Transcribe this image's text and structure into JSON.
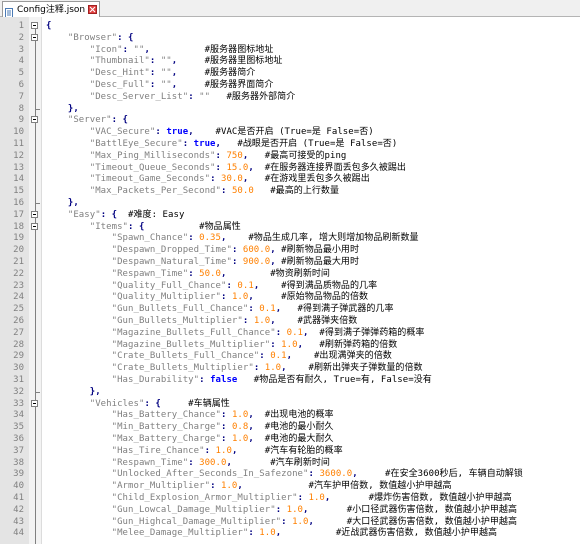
{
  "tab": {
    "label": "Config注释.json"
  },
  "lines": [
    {
      "n": "1",
      "fold": "open",
      "parts": [
        [
          "p",
          "{"
        ]
      ]
    },
    {
      "n": "2",
      "fold": "open",
      "parts": [
        [
          "k",
          "    \"Browser\""
        ],
        [
          "p",
          ": {"
        ]
      ]
    },
    {
      "n": "3",
      "parts": [
        [
          "k",
          "        \"Icon\""
        ],
        [
          "p",
          ": "
        ],
        [
          "s",
          "\"\""
        ],
        [
          "p",
          ","
        ],
        [
          "c",
          "          #服务器图标地址"
        ]
      ]
    },
    {
      "n": "4",
      "parts": [
        [
          "k",
          "        \"Thumbnail\""
        ],
        [
          "p",
          ": "
        ],
        [
          "s",
          "\"\""
        ],
        [
          "p",
          ","
        ],
        [
          "c",
          "     #服务器里图标地址"
        ]
      ]
    },
    {
      "n": "5",
      "parts": [
        [
          "k",
          "        \"Desc_Hint\""
        ],
        [
          "p",
          ": "
        ],
        [
          "s",
          "\"\""
        ],
        [
          "p",
          ","
        ],
        [
          "c",
          "     #服务器简介"
        ]
      ]
    },
    {
      "n": "6",
      "parts": [
        [
          "k",
          "        \"Desc_Full\""
        ],
        [
          "p",
          ": "
        ],
        [
          "s",
          "\"\""
        ],
        [
          "p",
          ","
        ],
        [
          "c",
          "     #服务器界面简介"
        ]
      ]
    },
    {
      "n": "7",
      "parts": [
        [
          "k",
          "        \"Desc_Server_List\""
        ],
        [
          "p",
          ": "
        ],
        [
          "s",
          "\"\""
        ],
        [
          "c",
          "   #服务器外部简介"
        ]
      ]
    },
    {
      "n": "8",
      "fold": "end",
      "parts": [
        [
          "p",
          "    },"
        ]
      ]
    },
    {
      "n": "9",
      "fold": "open",
      "parts": [
        [
          "k",
          "    \"Server\""
        ],
        [
          "p",
          ": {"
        ]
      ]
    },
    {
      "n": "10",
      "parts": [
        [
          "k",
          "        \"VAC_Secure\""
        ],
        [
          "p",
          ": "
        ],
        [
          "b",
          "true"
        ],
        [
          "p",
          ","
        ],
        [
          "c",
          "    #VAC是否开启 (True=是 False=否)"
        ]
      ]
    },
    {
      "n": "11",
      "parts": [
        [
          "k",
          "        \"BattlEye_Secure\""
        ],
        [
          "p",
          ": "
        ],
        [
          "b",
          "true"
        ],
        [
          "p",
          ","
        ],
        [
          "c",
          "   #战眼是否开启 (True=是 False=否)"
        ]
      ]
    },
    {
      "n": "12",
      "parts": [
        [
          "k",
          "        \"Max_Ping_Milliseconds\""
        ],
        [
          "p",
          ": "
        ],
        [
          "n",
          "750"
        ],
        [
          "p",
          ","
        ],
        [
          "c",
          "   #最高可接受的ping"
        ]
      ]
    },
    {
      "n": "13",
      "parts": [
        [
          "k",
          "        \"Timeout_Queue_Seconds\""
        ],
        [
          "p",
          ": "
        ],
        [
          "n",
          "15.0"
        ],
        [
          "p",
          ","
        ],
        [
          "c",
          "  #在服务器连接界面丢包多久被踢出"
        ]
      ]
    },
    {
      "n": "14",
      "parts": [
        [
          "k",
          "        \"Timeout_Game_Seconds\""
        ],
        [
          "p",
          ": "
        ],
        [
          "n",
          "30.0"
        ],
        [
          "p",
          ","
        ],
        [
          "c",
          "   #在游戏里丢包多久被踢出"
        ]
      ]
    },
    {
      "n": "15",
      "parts": [
        [
          "k",
          "        \"Max_Packets_Per_Second\""
        ],
        [
          "p",
          ": "
        ],
        [
          "n",
          "50.0"
        ],
        [
          "c",
          "   #最高的上行数量"
        ]
      ]
    },
    {
      "n": "16",
      "fold": "end",
      "parts": [
        [
          "p",
          "    },"
        ]
      ]
    },
    {
      "n": "17",
      "fold": "open",
      "parts": [
        [
          "k",
          "    \"Easy\""
        ],
        [
          "p",
          ": {"
        ],
        [
          "c",
          "  #难度: Easy"
        ]
      ]
    },
    {
      "n": "18",
      "fold": "open",
      "parts": [
        [
          "k",
          "        \"Items\""
        ],
        [
          "p",
          ": {"
        ],
        [
          "c",
          "          #物品属性"
        ]
      ]
    },
    {
      "n": "19",
      "parts": [
        [
          "k",
          "            \"Spawn_Chance\""
        ],
        [
          "p",
          ": "
        ],
        [
          "n",
          "0.35"
        ],
        [
          "p",
          ","
        ],
        [
          "c",
          "    #物品生成几率, 增大则增加物品刷新数量"
        ]
      ]
    },
    {
      "n": "20",
      "parts": [
        [
          "k",
          "            \"Despawn_Dropped_Time\""
        ],
        [
          "p",
          ": "
        ],
        [
          "n",
          "600.0"
        ],
        [
          "p",
          ","
        ],
        [
          "c",
          " #刷新物品最小用时"
        ]
      ]
    },
    {
      "n": "21",
      "parts": [
        [
          "k",
          "            \"Despawn_Natural_Time\""
        ],
        [
          "p",
          ": "
        ],
        [
          "n",
          "900.0"
        ],
        [
          "p",
          ","
        ],
        [
          "c",
          " #刷新物品最大用时"
        ]
      ]
    },
    {
      "n": "22",
      "parts": [
        [
          "k",
          "            \"Respawn_Time\""
        ],
        [
          "p",
          ": "
        ],
        [
          "n",
          "50.0"
        ],
        [
          "p",
          ","
        ],
        [
          "c",
          "        #物资刷新时间"
        ]
      ]
    },
    {
      "n": "23",
      "parts": [
        [
          "k",
          "            \"Quality_Full_Chance\""
        ],
        [
          "p",
          ": "
        ],
        [
          "n",
          "0.1"
        ],
        [
          "p",
          ","
        ],
        [
          "c",
          "    #得到满品质物品的几率"
        ]
      ]
    },
    {
      "n": "24",
      "parts": [
        [
          "k",
          "            \"Quality_Multiplier\""
        ],
        [
          "p",
          ": "
        ],
        [
          "n",
          "1.0"
        ],
        [
          "p",
          ","
        ],
        [
          "c",
          "     #原始物品物品的倍数"
        ]
      ]
    },
    {
      "n": "25",
      "parts": [
        [
          "k",
          "            \"Gun_Bullets_Full_Chance\""
        ],
        [
          "p",
          ": "
        ],
        [
          "n",
          "0.1"
        ],
        [
          "p",
          ","
        ],
        [
          "c",
          "   #得到满子弹武器的几率"
        ]
      ]
    },
    {
      "n": "26",
      "parts": [
        [
          "k",
          "            \"Gun_Bullets_Multiplier\""
        ],
        [
          "p",
          ": "
        ],
        [
          "n",
          "1.0"
        ],
        [
          "p",
          ","
        ],
        [
          "c",
          "    #武器弹夹倍数"
        ]
      ]
    },
    {
      "n": "27",
      "parts": [
        [
          "k",
          "            \"Magazine_Bullets_Full_Chance\""
        ],
        [
          "p",
          ": "
        ],
        [
          "n",
          "0.1"
        ],
        [
          "p",
          ","
        ],
        [
          "c",
          "  #得到满子弹弹药箱的概率"
        ]
      ]
    },
    {
      "n": "28",
      "parts": [
        [
          "k",
          "            \"Magazine_Bullets_Multiplier\""
        ],
        [
          "p",
          ": "
        ],
        [
          "n",
          "1.0"
        ],
        [
          "p",
          ","
        ],
        [
          "c",
          "   #刷新弹药箱的倍数"
        ]
      ]
    },
    {
      "n": "29",
      "parts": [
        [
          "k",
          "            \"Crate_Bullets_Full_Chance\""
        ],
        [
          "p",
          ": "
        ],
        [
          "n",
          "0.1"
        ],
        [
          "p",
          ","
        ],
        [
          "c",
          "    #出现满弹夹的倍数"
        ]
      ]
    },
    {
      "n": "30",
      "parts": [
        [
          "k",
          "            \"Crate_Bullets_Multiplier\""
        ],
        [
          "p",
          ": "
        ],
        [
          "n",
          "1.0"
        ],
        [
          "p",
          ","
        ],
        [
          "c",
          "    #刷新出弹夹子弹数量的倍数"
        ]
      ]
    },
    {
      "n": "31",
      "parts": [
        [
          "k",
          "            \"Has_Durability\""
        ],
        [
          "p",
          ": "
        ],
        [
          "b",
          "false"
        ],
        [
          "c",
          "   #物品是否有耐久, True=有, False=没有"
        ]
      ]
    },
    {
      "n": "32",
      "fold": "end",
      "parts": [
        [
          "p",
          "        },"
        ]
      ]
    },
    {
      "n": "33",
      "fold": "open",
      "parts": [
        [
          "k",
          "        \"Vehicles\""
        ],
        [
          "p",
          ": {"
        ],
        [
          "c",
          "     #车辆属性"
        ]
      ]
    },
    {
      "n": "34",
      "parts": [
        [
          "k",
          "            \"Has_Battery_Chance\""
        ],
        [
          "p",
          ": "
        ],
        [
          "n",
          "1.0"
        ],
        [
          "p",
          ","
        ],
        [
          "c",
          "  #出现电池的概率"
        ]
      ]
    },
    {
      "n": "35",
      "parts": [
        [
          "k",
          "            \"Min_Battery_Charge\""
        ],
        [
          "p",
          ": "
        ],
        [
          "n",
          "0.8"
        ],
        [
          "p",
          ","
        ],
        [
          "c",
          "  #电池的最小耐久"
        ]
      ]
    },
    {
      "n": "36",
      "parts": [
        [
          "k",
          "            \"Max_Battery_Charge\""
        ],
        [
          "p",
          ": "
        ],
        [
          "n",
          "1.0"
        ],
        [
          "p",
          ","
        ],
        [
          "c",
          "  #电池的最大耐久"
        ]
      ]
    },
    {
      "n": "37",
      "parts": [
        [
          "k",
          "            \"Has_Tire_Chance\""
        ],
        [
          "p",
          ": "
        ],
        [
          "n",
          "1.0"
        ],
        [
          "p",
          ","
        ],
        [
          "c",
          "     #汽车有轮胎的概率"
        ]
      ]
    },
    {
      "n": "38",
      "parts": [
        [
          "k",
          "            \"Respawn_Time\""
        ],
        [
          "p",
          ": "
        ],
        [
          "n",
          "300.0"
        ],
        [
          "p",
          ","
        ],
        [
          "c",
          "       #汽车刷新时间"
        ]
      ]
    },
    {
      "n": "39",
      "parts": [
        [
          "k",
          "            \"Unlocked_After_Seconds_In_Safezone\""
        ],
        [
          "p",
          ": "
        ],
        [
          "n",
          "3600.0"
        ],
        [
          "p",
          ","
        ],
        [
          "c",
          "     #在安全3600秒后, 车辆自动解锁"
        ]
      ]
    },
    {
      "n": "40",
      "parts": [
        [
          "k",
          "            \"Armor_Multiplier\""
        ],
        [
          "p",
          ": "
        ],
        [
          "n",
          "1.0"
        ],
        [
          "p",
          ","
        ],
        [
          "c",
          "            #汽车护甲倍数, 数值越小护甲越高"
        ]
      ]
    },
    {
      "n": "41",
      "parts": [
        [
          "k",
          "            \"Child_Explosion_Armor_Multiplier\""
        ],
        [
          "p",
          ": "
        ],
        [
          "n",
          "1.0"
        ],
        [
          "p",
          ","
        ],
        [
          "c",
          "       #爆炸伤害倍数, 数值越小护甲越高"
        ]
      ]
    },
    {
      "n": "42",
      "parts": [
        [
          "k",
          "            \"Gun_Lowcal_Damage_Multiplier\""
        ],
        [
          "p",
          ": "
        ],
        [
          "n",
          "1.0"
        ],
        [
          "p",
          ","
        ],
        [
          "c",
          "       #小口径武器伤害倍数, 数值越小护甲越高"
        ]
      ]
    },
    {
      "n": "43",
      "parts": [
        [
          "k",
          "            \"Gun_Highcal_Damage_Multiplier\""
        ],
        [
          "p",
          ": "
        ],
        [
          "n",
          "1.0"
        ],
        [
          "p",
          ","
        ],
        [
          "c",
          "      #大口径武器伤害倍数, 数值越小护甲越高"
        ]
      ]
    },
    {
      "n": "44",
      "parts": [
        [
          "k",
          "            \"Melee_Damage_Multiplier\""
        ],
        [
          "p",
          ": "
        ],
        [
          "n",
          "1.0"
        ],
        [
          "p",
          ","
        ],
        [
          "c",
          "          #近战武器伤害倍数, 数值越小护甲越高"
        ]
      ]
    }
  ]
}
